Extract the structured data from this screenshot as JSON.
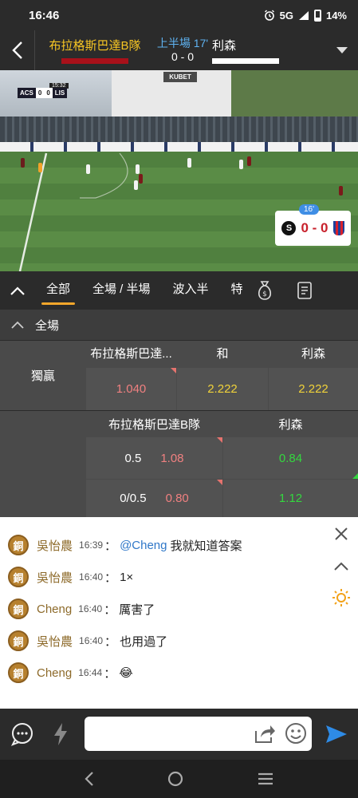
{
  "status_bar": {
    "time": "16:46",
    "network": "5G",
    "battery": "14%"
  },
  "match": {
    "home_team": "布拉格斯巴達B隊",
    "away_team": "利森",
    "period": "上半場 17'",
    "score": "0 - 0",
    "colors": {
      "home": "#a8111a",
      "away": "#ffffff",
      "accent": "#f7c623"
    }
  },
  "video": {
    "sponsor_logo": "KUBET",
    "broadcast_clock": "15:32",
    "broadcast_home": "ACS",
    "broadcast_home_score": "0",
    "broadcast_away_score": "0",
    "broadcast_away": "LIS",
    "widget_minute": "16'",
    "widget_home_logo": "S",
    "widget_score": "0 - 0"
  },
  "tabs": [
    {
      "label": "全部",
      "active": true
    },
    {
      "label": "全場 / 半場"
    },
    {
      "label": "波入半"
    },
    {
      "label": "特"
    }
  ],
  "section": {
    "title": "全場"
  },
  "moneyline": {
    "label": "獨贏",
    "headers": [
      "布拉格斯巴達...",
      "和",
      "利森"
    ],
    "odds": [
      "1.040",
      "2.222",
      "2.222"
    ]
  },
  "handicap": {
    "headers": [
      "布拉格斯巴達B隊",
      "利森"
    ],
    "rows": [
      {
        "line": "0.5",
        "home_odd": "1.08",
        "away_odd": "0.84"
      },
      {
        "line": "0/0.5",
        "home_odd": "0.80",
        "away_odd": "1.12"
      }
    ]
  },
  "chat": {
    "messages": [
      {
        "badge": "銅",
        "user": "吳怡農",
        "time": "16:39",
        "mention": "@Cheng",
        "text": "我就知道答案"
      },
      {
        "badge": "銅",
        "user": "吳怡農",
        "time": "16:40",
        "mention": "",
        "text": "1×"
      },
      {
        "badge": "銅",
        "user": "Cheng",
        "time": "16:40",
        "mention": "",
        "text": "厲害了"
      },
      {
        "badge": "銅",
        "user": "吳怡農",
        "time": "16:40",
        "mention": "",
        "text": "也用過了"
      },
      {
        "badge": "銅",
        "user": "Cheng",
        "time": "16:44",
        "mention": "",
        "text": "😂"
      }
    ],
    "separator": "："
  },
  "input": {
    "placeholder": ""
  }
}
